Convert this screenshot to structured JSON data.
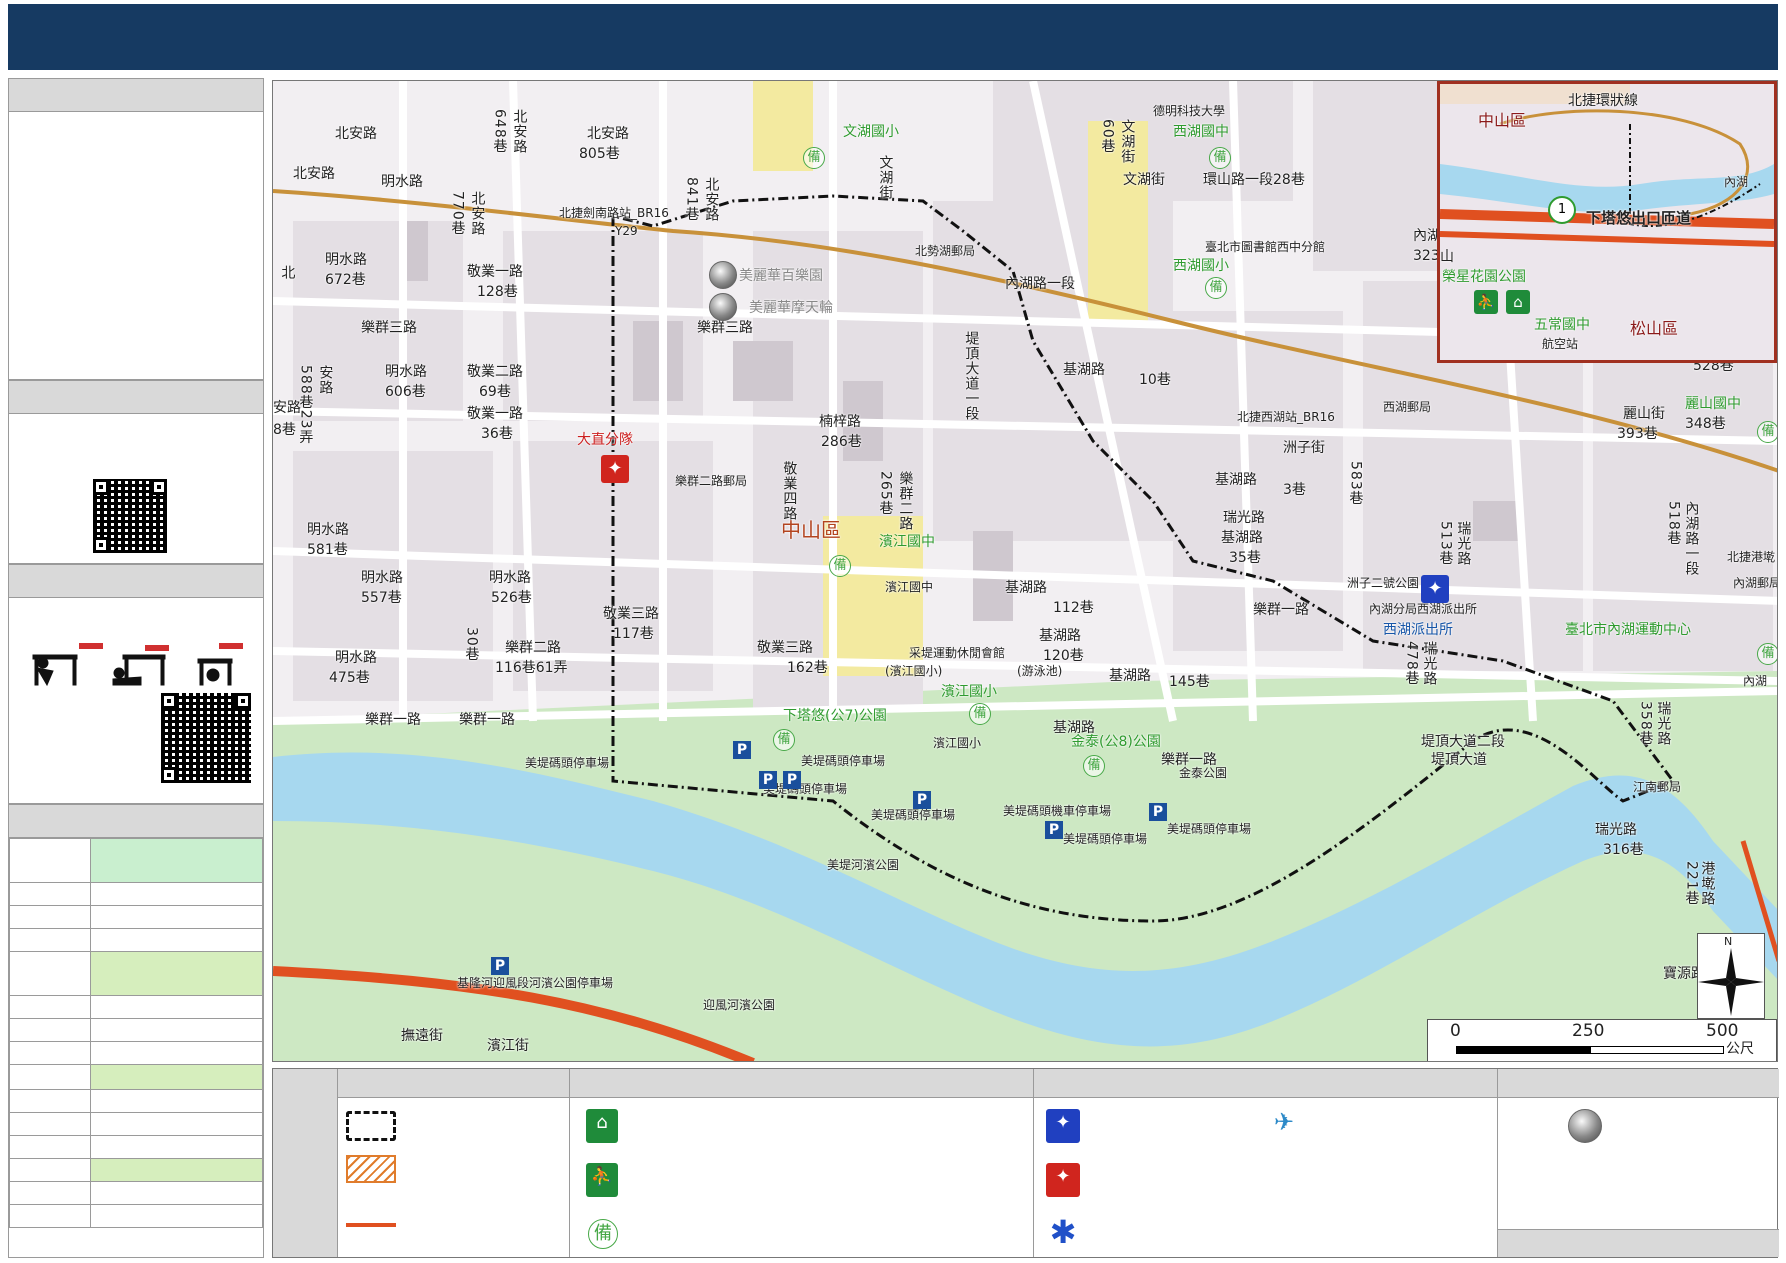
{
  "map": {
    "district_label": "中山區",
    "roads": [
      "北安路",
      "明水路",
      "北安路",
      "北安路",
      "770巷",
      "明水路",
      "672巷",
      "樂群三路",
      "敬業一路",
      "128巷",
      "明水路",
      "606巷",
      "敬業二路",
      "69巷",
      "敬業一路",
      "36巷",
      "明水路",
      "581巷",
      "明水路",
      "557巷",
      "明水路",
      "526巷",
      "敬業三路",
      "117巷",
      "樂群二路",
      "116巷61弄",
      "明水路",
      "475巷",
      "樂群一路",
      "樂群一路",
      "樂群三路",
      "敬業四路",
      "樂群二路",
      "265巷",
      "楠梓路",
      "286巷",
      "敬業三路",
      "162巷",
      "樂群一路",
      "基湖路",
      "基湖路",
      "112巷",
      "基湖路",
      "120巷",
      "基湖路",
      "145巷",
      "基湖路",
      "10巷",
      "基湖路",
      "3巷",
      "基湖路",
      "35巷",
      "瑞光路",
      "583巷",
      "洲子街",
      "瑞光路",
      "513巷",
      "瑞光路",
      "478巷",
      "瑞光路",
      "358巷",
      "瑞光路",
      "316巷",
      "港墘路",
      "221巷",
      "堤頂大道二段",
      "堤頂大道",
      "堤頂大道一段",
      "內湖路一段",
      "內湖路一段",
      "323巷",
      "文湖街",
      "文湖街",
      "60巷",
      "文湖街",
      "環山路一段28巷",
      "北安路",
      "841巷",
      "北安路",
      "805巷",
      "北安路",
      "648巷",
      "內湖路一段",
      "518巷",
      "安路",
      "588巷23弄",
      "安路",
      "8巷",
      "麗山街",
      "393巷",
      "麗山國中",
      "348巷",
      "528巷",
      "樂群一路",
      "30巷",
      "北",
      "寶源路"
    ],
    "places": [
      "北捷劍南路站_BR16",
      "Y29",
      "美麗華百樂園",
      "美麗華摩天輪",
      "大直分隊",
      "樂群二路郵局",
      "北勢湖郵局",
      "文湖國小",
      "西湖國中",
      "西湖國小",
      "臺北市圖書館西中分館",
      "德明科技大學",
      "北捷西湖站_BR16",
      "西湖郵局",
      "濱江國中",
      "濱江國中",
      "采堤運動休閒會館",
      "(濱江國小)",
      "(游泳池)",
      "濱江國小",
      "濱江國小",
      "下塔悠(公7)公園",
      "金泰(公8)公園",
      "金泰公園",
      "美堤碼頭停車場",
      "美堤碼頭停車場",
      "美堤碼頭停車場",
      "美堤碼頭停車場",
      "美堤碼頭停車場",
      "美堤碼頭停車場",
      "美堤碼頭機車停車場",
      "美堤河濱公園",
      "基隆河迎風段河濱公園停車場",
      "迎風河濱公園",
      "撫遠街",
      "濱江街",
      "洲子二號公園",
      "內湖分局西湖派出所",
      "西湖派出所",
      "臺北市內湖運動中心",
      "內湖",
      "北捷港墘",
      "內湖郵局",
      "江南郵局",
      "大直分隊",
      "麗山國中",
      "內湖"
    ],
    "scale": {
      "ticks": [
        "0",
        "250",
        "500"
      ],
      "unit": "公尺"
    },
    "north": "N",
    "inset": {
      "labels": [
        "中山區",
        "北捷環狀線",
        "內湖",
        "下塔悠出口匝道",
        "1",
        "榮星花園公園",
        "五常國中",
        "松山區",
        "航空站",
        "山"
      ]
    }
  },
  "colors": {
    "title_bar": "#163a62",
    "river": "#a7d8ef",
    "park": "#c7e7bf",
    "road_major": "#e05020",
    "route_metro": "#c8913a",
    "building": "#d8d2d8",
    "school": "#f3eaa0"
  },
  "icons": [
    "shelter-icon",
    "evacuation-icon",
    "backup-icon",
    "police-icon",
    "fire-icon",
    "ambulance-icon",
    "helicopter-icon",
    "landmark-icon"
  ]
}
